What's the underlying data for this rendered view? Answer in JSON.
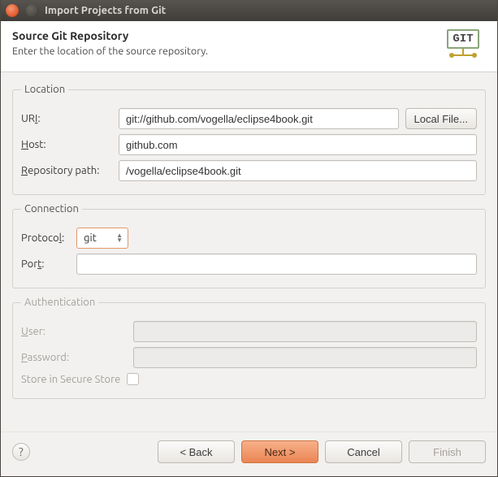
{
  "window": {
    "title": "Import Projects from Git"
  },
  "header": {
    "title": "Source Git Repository",
    "subtitle": "Enter the location of the source repository.",
    "git_label": "GIT"
  },
  "location": {
    "legend": "Location",
    "uri_label": "URI:",
    "uri_value": "git://github.com/vogella/eclipse4book.git",
    "local_file_label": "Local File...",
    "host_label": "Host:",
    "host_value": "github.com",
    "repo_label": "Repository path:",
    "repo_value": "/vogella/eclipse4book.git"
  },
  "connection": {
    "legend": "Connection",
    "protocol_label": "Protocol:",
    "protocol_value": "git",
    "port_label": "Port:",
    "port_value": ""
  },
  "auth": {
    "legend": "Authentication",
    "user_label": "User:",
    "user_value": "",
    "password_label": "Password:",
    "password_value": "",
    "store_label": "Store in Secure Store"
  },
  "footer": {
    "back": "< Back",
    "next": "Next >",
    "cancel": "Cancel",
    "finish": "Finish"
  }
}
